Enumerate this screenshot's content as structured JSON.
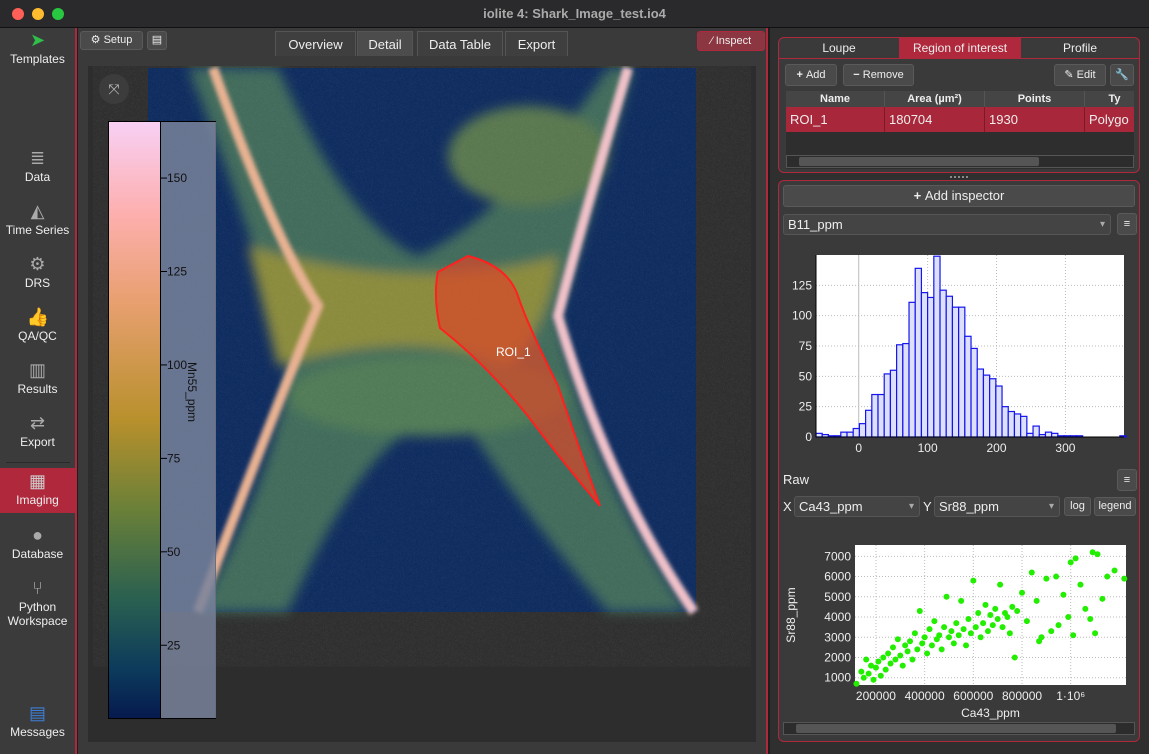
{
  "window": {
    "title": "iolite 4: Shark_Image_test.io4"
  },
  "sidebar": {
    "items": [
      {
        "label": "Templates",
        "icon": "paper-plane-icon"
      },
      {
        "label": "Data",
        "icon": "database-icon"
      },
      {
        "label": "Time Series",
        "icon": "area-chart-icon"
      },
      {
        "label": "DRS",
        "icon": "gear-icon"
      },
      {
        "label": "QA/QC",
        "icon": "thumbs-up-icon"
      },
      {
        "label": "Results",
        "icon": "bar-chart-icon"
      },
      {
        "label": "Export",
        "icon": "arrows-exchange-icon"
      },
      {
        "label": "Imaging",
        "icon": "map-icon",
        "active": true
      },
      {
        "label": "Database",
        "icon": "globe-icon"
      },
      {
        "label": "Python Workspace",
        "icon": "branch-icon"
      },
      {
        "label": "Messages",
        "icon": "messages-icon"
      }
    ]
  },
  "toolbar": {
    "setup_label": "Setup",
    "inspect_label": "Inspect",
    "tabs": [
      {
        "label": "Overview"
      },
      {
        "label": "Detail",
        "active": true
      },
      {
        "label": "Data Table"
      },
      {
        "label": "Export"
      }
    ]
  },
  "image_view": {
    "colorbar": {
      "label": "Mn55_ppm",
      "ticks": [
        "150",
        "125",
        "100",
        "75",
        "50",
        "25"
      ],
      "tick_values": [
        150,
        125,
        100,
        75,
        50,
        25
      ],
      "range": [
        5,
        165
      ]
    },
    "roi_label": "ROI_1"
  },
  "roi_panel": {
    "tabs": [
      {
        "label": "Loupe"
      },
      {
        "label": "Region of interest",
        "active": true
      },
      {
        "label": "Profile"
      }
    ],
    "add_label": "Add",
    "remove_label": "Remove",
    "edit_label": "Edit",
    "columns": [
      "Name",
      "Area (µm²)",
      "Points",
      "Ty"
    ],
    "rows": [
      {
        "name": "ROI_1",
        "area": "180704",
        "points": "1930",
        "type": "Polygo"
      }
    ]
  },
  "inspector": {
    "add_inspector_label": "Add inspector",
    "hist_channel": "B11_ppm",
    "raw_label": "Raw",
    "x_label": "X",
    "y_label": "Y",
    "x_channel": "Ca43_ppm",
    "y_channel": "Sr88_ppm",
    "log_label": "log",
    "legend_label": "legend"
  },
  "chart_data": [
    {
      "type": "bar",
      "series_name": "B11_ppm",
      "xlim": [
        -62,
        385
      ],
      "ylim": [
        0,
        150
      ],
      "xticks": [
        "0",
        "100",
        "200",
        "300"
      ],
      "xtick_values": [
        0,
        100,
        200,
        300
      ],
      "yticks": [
        "0",
        "25",
        "50",
        "75",
        "100",
        "125"
      ],
      "ytick_values": [
        0,
        25,
        50,
        75,
        100,
        125
      ],
      "bin_start": -62,
      "bin_width": 9,
      "counts": [
        3,
        2,
        1,
        1,
        4,
        4,
        7,
        11,
        22,
        35,
        35,
        52,
        55,
        76,
        77,
        111,
        139,
        119,
        115,
        149,
        121,
        116,
        107,
        107,
        83,
        73,
        56,
        51,
        48,
        42,
        25,
        21,
        19,
        17,
        3,
        9,
        2,
        4,
        3,
        1,
        1,
        1,
        1,
        0,
        0,
        0,
        0,
        0,
        0,
        1
      ]
    },
    {
      "type": "scatter",
      "xlabel": "Ca43_ppm",
      "ylabel": "Sr88_ppm",
      "xlim": [
        114000,
        1227000
      ],
      "ylim": [
        640,
        7560
      ],
      "xticks": [
        "200000",
        "400000",
        "600000",
        "800000",
        "1·10⁶"
      ],
      "xtick_values": [
        200000,
        400000,
        600000,
        800000,
        1000000
      ],
      "yticks": [
        "1000",
        "2000",
        "3000",
        "4000",
        "5000",
        "6000",
        "7000"
      ],
      "ytick_values": [
        1000,
        2000,
        3000,
        4000,
        5000,
        6000,
        7000
      ],
      "color": "#22ee00",
      "points": [
        [
          120000,
          700
        ],
        [
          140000,
          1300
        ],
        [
          150000,
          1000
        ],
        [
          160000,
          1900
        ],
        [
          170000,
          1200
        ],
        [
          180000,
          1600
        ],
        [
          190000,
          900
        ],
        [
          200000,
          1500
        ],
        [
          210000,
          1800
        ],
        [
          220000,
          1100
        ],
        [
          230000,
          2000
        ],
        [
          240000,
          1400
        ],
        [
          250000,
          2200
        ],
        [
          260000,
          1700
        ],
        [
          270000,
          2500
        ],
        [
          280000,
          1900
        ],
        [
          290000,
          2900
        ],
        [
          300000,
          2100
        ],
        [
          310000,
          1600
        ],
        [
          320000,
          2600
        ],
        [
          330000,
          2300
        ],
        [
          340000,
          2800
        ],
        [
          350000,
          1900
        ],
        [
          360000,
          3200
        ],
        [
          370000,
          2400
        ],
        [
          380000,
          4300
        ],
        [
          390000,
          2700
        ],
        [
          400000,
          3000
        ],
        [
          410000,
          2200
        ],
        [
          420000,
          3400
        ],
        [
          430000,
          2600
        ],
        [
          440000,
          3800
        ],
        [
          450000,
          2900
        ],
        [
          460000,
          3100
        ],
        [
          470000,
          2400
        ],
        [
          480000,
          3500
        ],
        [
          490000,
          5000
        ],
        [
          500000,
          3000
        ],
        [
          510000,
          3300
        ],
        [
          520000,
          2700
        ],
        [
          530000,
          3700
        ],
        [
          540000,
          3100
        ],
        [
          550000,
          4800
        ],
        [
          560000,
          3400
        ],
        [
          570000,
          2600
        ],
        [
          580000,
          3900
        ],
        [
          590000,
          3200
        ],
        [
          600000,
          5800
        ],
        [
          610000,
          3500
        ],
        [
          620000,
          4200
        ],
        [
          630000,
          3000
        ],
        [
          640000,
          3700
        ],
        [
          650000,
          4600
        ],
        [
          660000,
          3300
        ],
        [
          670000,
          4100
        ],
        [
          680000,
          3600
        ],
        [
          690000,
          4400
        ],
        [
          700000,
          3900
        ],
        [
          710000,
          5600
        ],
        [
          720000,
          3500
        ],
        [
          730000,
          4200
        ],
        [
          740000,
          4000
        ],
        [
          750000,
          3200
        ],
        [
          760000,
          4500
        ],
        [
          770000,
          2000
        ],
        [
          780000,
          4300
        ],
        [
          800000,
          5200
        ],
        [
          820000,
          3800
        ],
        [
          840000,
          6200
        ],
        [
          860000,
          4800
        ],
        [
          870000,
          2800
        ],
        [
          880000,
          3000
        ],
        [
          900000,
          5900
        ],
        [
          920000,
          3300
        ],
        [
          940000,
          6000
        ],
        [
          950000,
          3600
        ],
        [
          970000,
          5100
        ],
        [
          990000,
          4000
        ],
        [
          1000000,
          6700
        ],
        [
          1010000,
          3100
        ],
        [
          1020000,
          6900
        ],
        [
          1040000,
          5600
        ],
        [
          1060000,
          4400
        ],
        [
          1080000,
          3900
        ],
        [
          1090000,
          7200
        ],
        [
          1100000,
          3200
        ],
        [
          1110000,
          7100
        ],
        [
          1130000,
          4900
        ],
        [
          1150000,
          6000
        ],
        [
          1180000,
          6300
        ],
        [
          1220000,
          5900
        ]
      ]
    }
  ]
}
